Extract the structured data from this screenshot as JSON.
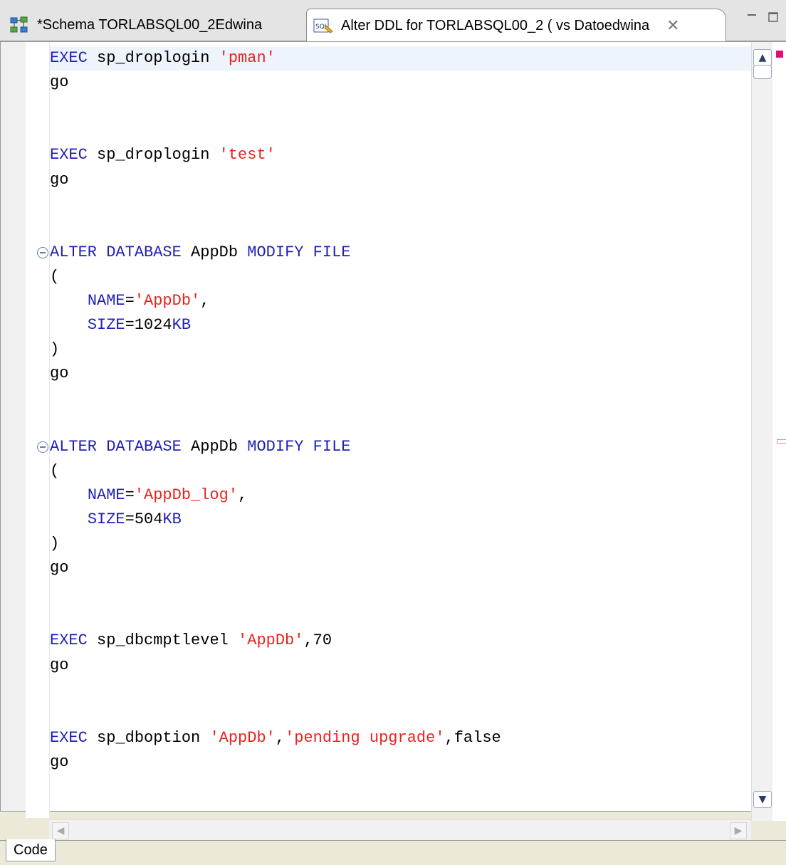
{
  "tabs": [
    {
      "label": "*Schema TORLABSQL00_2Edwina",
      "icon": "schema-diagram-icon"
    },
    {
      "label": "Alter DDL for TORLABSQL00_2  ( vs Datoedwina",
      "icon": "sql-file-icon",
      "close_icon": "close-icon"
    }
  ],
  "window_controls": {
    "minimize_icon": "minimize-icon",
    "maximize_icon": "maximize-icon"
  },
  "bottom_tab": {
    "label": "Code"
  },
  "colors": {
    "keyword": "#1f1fb8",
    "string": "#e8231c",
    "text": "#000000",
    "overview_error": "#e60a73"
  },
  "code_lines": [
    {
      "parts": [
        [
          "kw",
          "EXEC"
        ],
        [
          "txt",
          " sp_droplogin "
        ],
        [
          "str",
          "'pman'"
        ]
      ],
      "current": true
    },
    {
      "parts": [
        [
          "txt",
          "go"
        ]
      ]
    },
    {
      "parts": []
    },
    {
      "parts": []
    },
    {
      "parts": [
        [
          "kw",
          "EXEC"
        ],
        [
          "txt",
          " sp_droplogin "
        ],
        [
          "str",
          "'test'"
        ]
      ]
    },
    {
      "parts": [
        [
          "txt",
          "go"
        ]
      ]
    },
    {
      "parts": []
    },
    {
      "parts": []
    },
    {
      "parts": [
        [
          "kw",
          "ALTER DATABASE"
        ],
        [
          "txt",
          " AppDb "
        ],
        [
          "kw",
          "MODIFY FILE"
        ]
      ],
      "fold": true
    },
    {
      "parts": [
        [
          "txt",
          "("
        ]
      ]
    },
    {
      "parts": [
        [
          "txt",
          "    "
        ],
        [
          "kw",
          "NAME"
        ],
        [
          "txt",
          "="
        ],
        [
          "str",
          "'AppDb'"
        ],
        [
          "txt",
          ","
        ]
      ]
    },
    {
      "parts": [
        [
          "txt",
          "    "
        ],
        [
          "kw",
          "SIZE"
        ],
        [
          "txt",
          "=1024"
        ],
        [
          "kw",
          "KB"
        ]
      ]
    },
    {
      "parts": [
        [
          "txt",
          ")"
        ]
      ]
    },
    {
      "parts": [
        [
          "txt",
          "go"
        ]
      ]
    },
    {
      "parts": []
    },
    {
      "parts": []
    },
    {
      "parts": [
        [
          "kw",
          "ALTER DATABASE"
        ],
        [
          "txt",
          " AppDb "
        ],
        [
          "kw",
          "MODIFY FILE"
        ]
      ],
      "fold": true
    },
    {
      "parts": [
        [
          "txt",
          "("
        ]
      ]
    },
    {
      "parts": [
        [
          "txt",
          "    "
        ],
        [
          "kw",
          "NAME"
        ],
        [
          "txt",
          "="
        ],
        [
          "str",
          "'AppDb_log'"
        ],
        [
          "txt",
          ","
        ]
      ]
    },
    {
      "parts": [
        [
          "txt",
          "    "
        ],
        [
          "kw",
          "SIZE"
        ],
        [
          "txt",
          "=504"
        ],
        [
          "kw",
          "KB"
        ]
      ]
    },
    {
      "parts": [
        [
          "txt",
          ")"
        ]
      ]
    },
    {
      "parts": [
        [
          "txt",
          "go"
        ]
      ]
    },
    {
      "parts": []
    },
    {
      "parts": []
    },
    {
      "parts": [
        [
          "kw",
          "EXEC"
        ],
        [
          "txt",
          " sp_dbcmptlevel "
        ],
        [
          "str",
          "'AppDb'"
        ],
        [
          "txt",
          ",70"
        ]
      ]
    },
    {
      "parts": [
        [
          "txt",
          "go"
        ]
      ]
    },
    {
      "parts": []
    },
    {
      "parts": []
    },
    {
      "parts": [
        [
          "kw",
          "EXEC"
        ],
        [
          "txt",
          " sp_dboption "
        ],
        [
          "str",
          "'AppDb'"
        ],
        [
          "txt",
          ","
        ],
        [
          "str",
          "'pending upgrade'"
        ],
        [
          "txt",
          ",false"
        ]
      ]
    },
    {
      "parts": [
        [
          "txt",
          "go"
        ]
      ]
    }
  ]
}
